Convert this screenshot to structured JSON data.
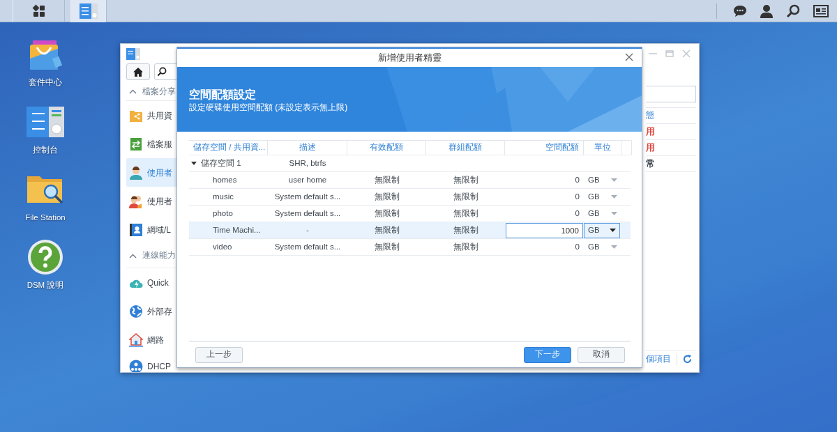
{
  "desktop_icons": [
    {
      "kind": "package",
      "label": "套件中心"
    },
    {
      "kind": "control",
      "label": "控制台"
    },
    {
      "kind": "files",
      "label": "File Station"
    },
    {
      "kind": "help",
      "label": "DSM 說明"
    }
  ],
  "control_panel": {
    "sidebar": [
      {
        "kind": "section",
        "label": "檔案分享",
        "expanded": true
      },
      {
        "kind": "item",
        "label": "共用資",
        "selected": false
      },
      {
        "kind": "item",
        "label": "檔案服",
        "selected": false
      },
      {
        "kind": "item",
        "label": "使用者",
        "selected": true
      },
      {
        "kind": "item",
        "label": "使用者",
        "selected": false
      },
      {
        "kind": "item",
        "label": "網域/L",
        "selected": false
      },
      {
        "kind": "section",
        "label": "連線能力",
        "expanded": true
      },
      {
        "kind": "item",
        "label": "Quick",
        "selected": false
      },
      {
        "kind": "item",
        "label": "外部存",
        "selected": false
      },
      {
        "kind": "item",
        "label": "網路",
        "selected": false
      },
      {
        "kind": "item",
        "label": "DHCP",
        "selected": false
      }
    ],
    "status_header": "態",
    "status_cells": [
      {
        "text": "用",
        "color": "#e0463c"
      },
      {
        "text": "用",
        "color": "#e0463c"
      },
      {
        "text": "常",
        "color": "#404850"
      }
    ],
    "footer_text": "個項目"
  },
  "wizard": {
    "title": "新增使用者精靈",
    "heading": "空間配額設定",
    "subtitle": "設定硬碟使用空間配額 (未設定表示無上限)",
    "columns": [
      "儲存空間 / 共用資...",
      "描述",
      "有效配額",
      "群組配額",
      "空間配額",
      "單位"
    ],
    "volume": {
      "name": "儲存空間 1",
      "description": "SHR, btrfs",
      "expanded": true
    },
    "rows": [
      {
        "name": "homes",
        "description": "user home",
        "effective": "無限制",
        "group": "無限制",
        "quota": "0",
        "unit": "GB",
        "selected": false
      },
      {
        "name": "music",
        "description": "System default s...",
        "effective": "無限制",
        "group": "無限制",
        "quota": "0",
        "unit": "GB",
        "selected": false
      },
      {
        "name": "photo",
        "description": "System default s...",
        "effective": "無限制",
        "group": "無限制",
        "quota": "0",
        "unit": "GB",
        "selected": false
      },
      {
        "name": "Time Machi...",
        "description": "-",
        "effective": "無限制",
        "group": "無限制",
        "quota": "1000",
        "unit": "GB",
        "selected": true
      },
      {
        "name": "video",
        "description": "System default s...",
        "effective": "無限制",
        "group": "無限制",
        "quota": "0",
        "unit": "GB",
        "selected": false
      }
    ],
    "buttons": [
      {
        "label": "上一步",
        "kind": "back"
      },
      {
        "label": "下一步",
        "kind": "primary"
      },
      {
        "label": "取消",
        "kind": "secondary"
      }
    ]
  }
}
